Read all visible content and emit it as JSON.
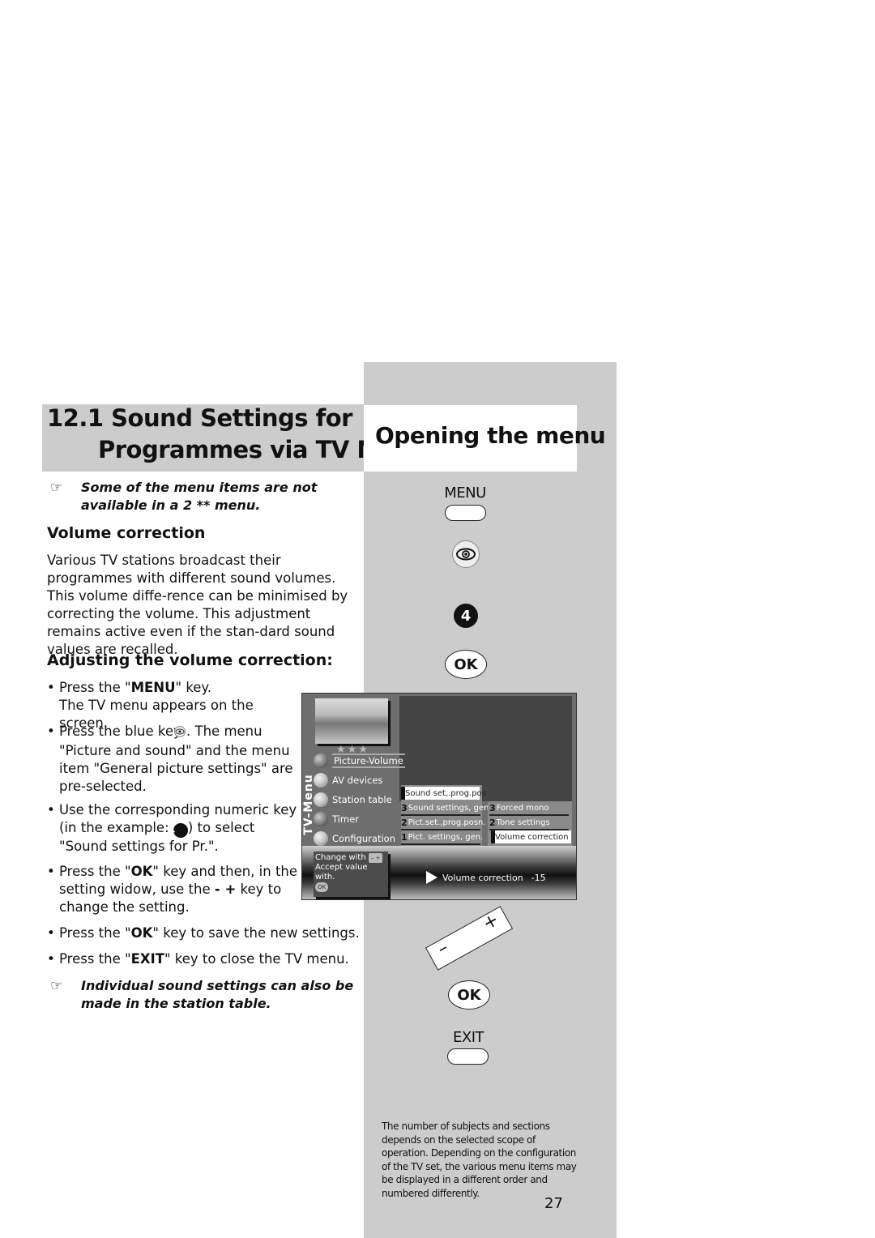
{
  "heading": {
    "number": "12.1",
    "line1": "12.1 Sound Settings for",
    "line2": "Programmes via TV Menu"
  },
  "side_heading": "Opening the menu",
  "note_top": {
    "icon": "pointing-hand-icon",
    "text": "Some of the menu items are not available in a 2 ** menu."
  },
  "section_volume": {
    "title": "Volume correction",
    "paragraph": "Various TV stations broadcast their programmes with different sound volumes. This volume diffe-rence can be minimised by correcting the volume. This adjustment remains active even if the stan-dard sound values are recalled."
  },
  "section_adjust": {
    "title": "Adjusting the volume correction:",
    "steps": [
      {
        "pre": "Press the \"",
        "bold": "MENU",
        "post": "\" key.",
        "extra": "The TV menu appears on the screen."
      },
      {
        "pre": "Press the blue key ",
        "post": ". The menu \"Picture and sound\" and the menu item \"General picture settings\" are pre-selected."
      },
      {
        "pre": "Use the corresponding numeric key (in the example: ",
        "key": "4",
        "post": ") to select \"Sound settings for Pr.\"."
      },
      {
        "pre": "Press the \"",
        "bold": "OK",
        "post": "\" key and then, in the setting widow, use the ",
        "keys": "- +",
        "post2": " key to change the setting."
      },
      {
        "pre": "Press the \"",
        "bold": "OK",
        "post": "\" key to save the new settings."
      },
      {
        "pre": "Press the \"",
        "bold": "EXIT",
        "post": "\" key to close the TV menu."
      }
    ]
  },
  "note_bottom": {
    "icon": "pointing-hand-icon",
    "text": "Individual sound settings can also be made in the station table."
  },
  "remote": {
    "menu_label": "MENU",
    "number_key": "4",
    "ok_label": "OK",
    "minus": "–",
    "plus": "+",
    "exit_label": "EXIT"
  },
  "tv_menu": {
    "side_title": "TV-Menu",
    "stars": "★★★",
    "items": [
      {
        "label": "Picture-Volume",
        "selected": true
      },
      {
        "label": "AV devices"
      },
      {
        "label": "Station table"
      },
      {
        "label": "Timer"
      },
      {
        "label": "Configuration"
      }
    ],
    "submenu": [
      {
        "num": "4",
        "label": "Sound set,.prog.pos",
        "selected": true
      },
      {
        "num": "3",
        "label": "Sound settings, gen."
      },
      {
        "num": "2",
        "label": "Pict.set.,prog.posn."
      },
      {
        "num": "1",
        "label": "Pict. settings, gen."
      }
    ],
    "subsubmenu": [
      {
        "num": "3",
        "label": "Forced mono"
      },
      {
        "num": "2",
        "label": "Tone settings"
      },
      {
        "num": "",
        "label": "Volume correction",
        "selected": true
      }
    ],
    "help": {
      "change": "Change with",
      "change_keys": "– +",
      "accept": "Accept value with.",
      "ok": "OK"
    },
    "value_label": "Volume correction",
    "value": "-15"
  },
  "footnote": "The number of subjects and sections depends on the selected scope of operation. Depending on the configuration of the TV set, the various menu items may be displayed in a different order and numbered differently.",
  "page_number": "27",
  "colors": {
    "panel_grey": "#cccccc",
    "tv_bg": "#6e6e6e",
    "tv_dark": "#444444"
  }
}
